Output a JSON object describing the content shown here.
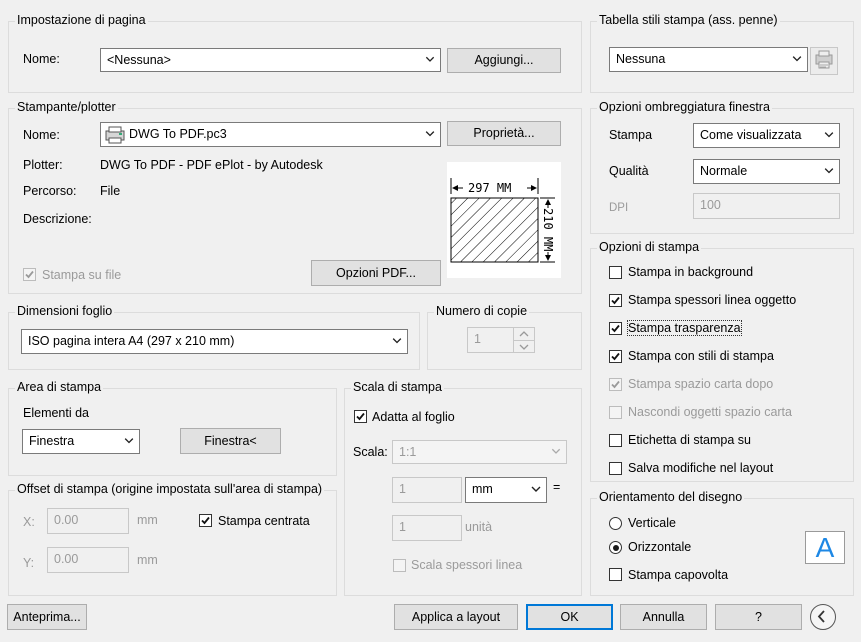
{
  "page_setup": {
    "title": "Impostazione di pagina",
    "name_label": "Nome:",
    "name_value": "<Nessuna>",
    "add_button": "Aggiungi..."
  },
  "printer": {
    "title": "Stampante/plotter",
    "name_label": "Nome:",
    "name_value": "DWG To PDF.pc3",
    "properties_button": "Proprietà...",
    "plotter_label": "Plotter:",
    "plotter_value": "DWG To PDF - PDF ePlot - by Autodesk",
    "path_label": "Percorso:",
    "path_value": "File",
    "description_label": "Descrizione:",
    "plot_to_file_label": "Stampa su file",
    "pdf_options_button": "Opzioni PDF...",
    "preview_width_label": "297 MM",
    "preview_height_label": "210 MM"
  },
  "paper_size": {
    "title": "Dimensioni foglio",
    "value": "ISO pagina intera A4 (297 x 210 mm)"
  },
  "copies": {
    "title": "Numero di copie",
    "value": "1"
  },
  "plot_area": {
    "title": "Area di stampa",
    "what_label": "Elementi da",
    "what_value": "Finestra",
    "window_button": "Finestra<"
  },
  "plot_scale": {
    "title": "Scala di stampa",
    "fit_label": "Adatta al foglio",
    "fit_checked": true,
    "scale_label": "Scala:",
    "scale_value": "1:1",
    "value1": "1",
    "unit_value": "mm",
    "equals": "=",
    "value2": "1",
    "units_label": "unità",
    "scale_lineweights_label": "Scala spessori linea"
  },
  "plot_offset": {
    "title": "Offset di stampa (origine impostata sull'area di stampa)",
    "x_label": "X:",
    "x_value": "0.00",
    "x_unit": "mm",
    "y_label": "Y:",
    "y_value": "0.00",
    "y_unit": "mm",
    "center_label": "Stampa centrata",
    "center_checked": true
  },
  "plot_style_table": {
    "title": "Tabella stili stampa (ass. penne)",
    "value": "Nessuna"
  },
  "shaded_viewport": {
    "title": "Opzioni ombreggiatura finestra",
    "shade_label": "Stampa",
    "shade_value": "Come visualizzata",
    "quality_label": "Qualità",
    "quality_value": "Normale",
    "dpi_label": "DPI",
    "dpi_value": "100"
  },
  "plot_options": {
    "title": "Opzioni di stampa",
    "items": [
      {
        "label": "Stampa in background",
        "checked": false,
        "enabled": true
      },
      {
        "label": "Stampa spessori linea oggetto",
        "checked": true,
        "enabled": true
      },
      {
        "label": "Stampa trasparenza",
        "checked": true,
        "enabled": true
      },
      {
        "label": "Stampa con stili di stampa",
        "checked": true,
        "enabled": true
      },
      {
        "label": "Stampa spazio carta dopo",
        "checked": true,
        "enabled": false
      },
      {
        "label": "Nascondi oggetti spazio carta",
        "checked": false,
        "enabled": false
      },
      {
        "label": "Etichetta di stampa su",
        "checked": false,
        "enabled": true
      },
      {
        "label": "Salva modifiche nel layout",
        "checked": false,
        "enabled": true
      }
    ]
  },
  "orientation": {
    "title": "Orientamento del disegno",
    "portrait_label": "Verticale",
    "landscape_label": "Orizzontale",
    "selected": "Orizzontale",
    "upside_down_label": "Stampa capovolta",
    "icon_letter": "A"
  },
  "footer": {
    "preview_button": "Anteprima...",
    "apply_button": "Applica a layout",
    "ok_button": "OK",
    "cancel_button": "Annulla",
    "help_button": "?"
  },
  "colors": {
    "accent": "#0078d7",
    "orientation_icon": "#1e88e5"
  }
}
